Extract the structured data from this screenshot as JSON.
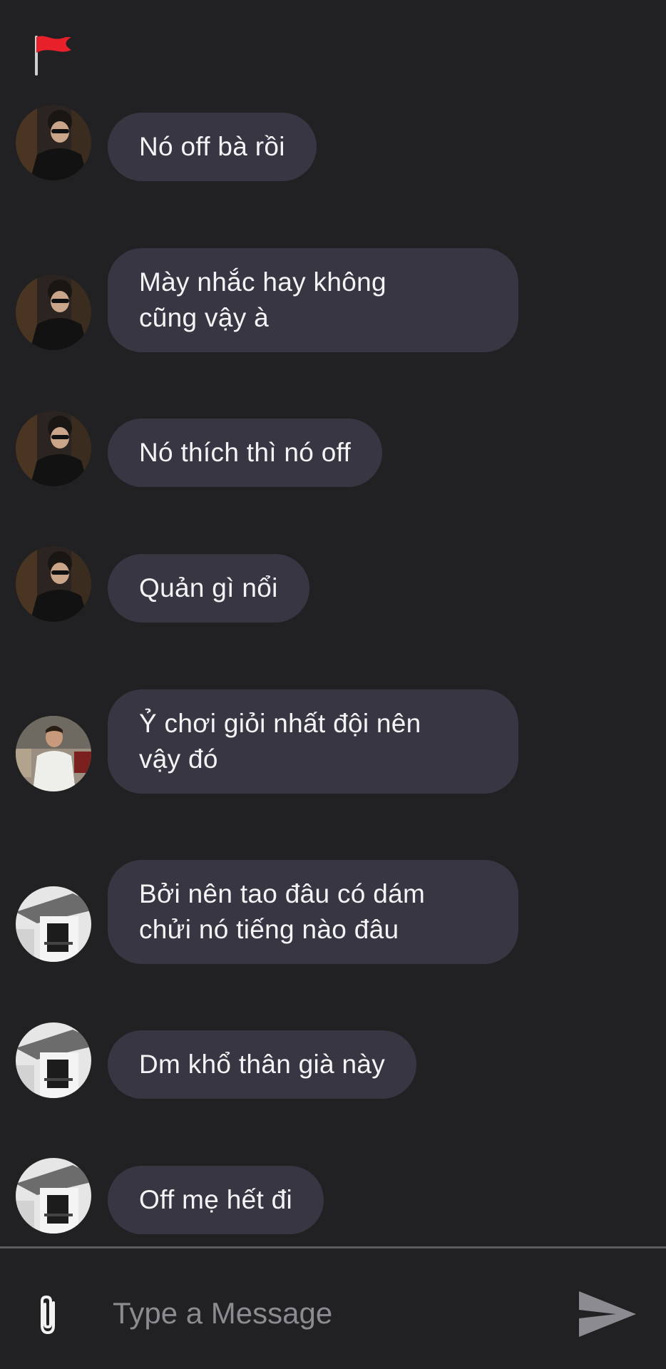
{
  "chat": {
    "flag_icon": "red-flag-icon",
    "messages": [
      {
        "avatar": "avatar-sunglasses",
        "lines": "Nó off bà rồi"
      },
      {
        "avatar": "avatar-sunglasses",
        "lines": "Mày nhắc hay không\ncũng vậy à"
      },
      {
        "avatar": "avatar-sunglasses",
        "lines": "Nó thích thì nó off"
      },
      {
        "avatar": "avatar-sunglasses",
        "lines": "Quản gì nổi"
      },
      {
        "avatar": "avatar-white-shirt",
        "lines": "Ỷ chơi giỏi nhất đội nên\nvậy đó"
      },
      {
        "avatar": "avatar-balcony",
        "lines": "Bởi nên tao đâu có dám\nchửi nó tiếng nào đâu"
      },
      {
        "avatar": "avatar-balcony",
        "lines": "Dm khổ thân già này"
      },
      {
        "avatar": "avatar-balcony",
        "lines": "Off mẹ hết đi"
      }
    ]
  },
  "composer": {
    "placeholder": "Type a Message",
    "value": "",
    "attach_icon": "paperclip-icon",
    "send_icon": "send-icon"
  },
  "colors": {
    "background": "#212124",
    "bubble": "#373642",
    "text": "#f4f4f6",
    "placeholder": "#8b8b91",
    "divider": "#5b5b61",
    "flag": "#e8202a"
  }
}
